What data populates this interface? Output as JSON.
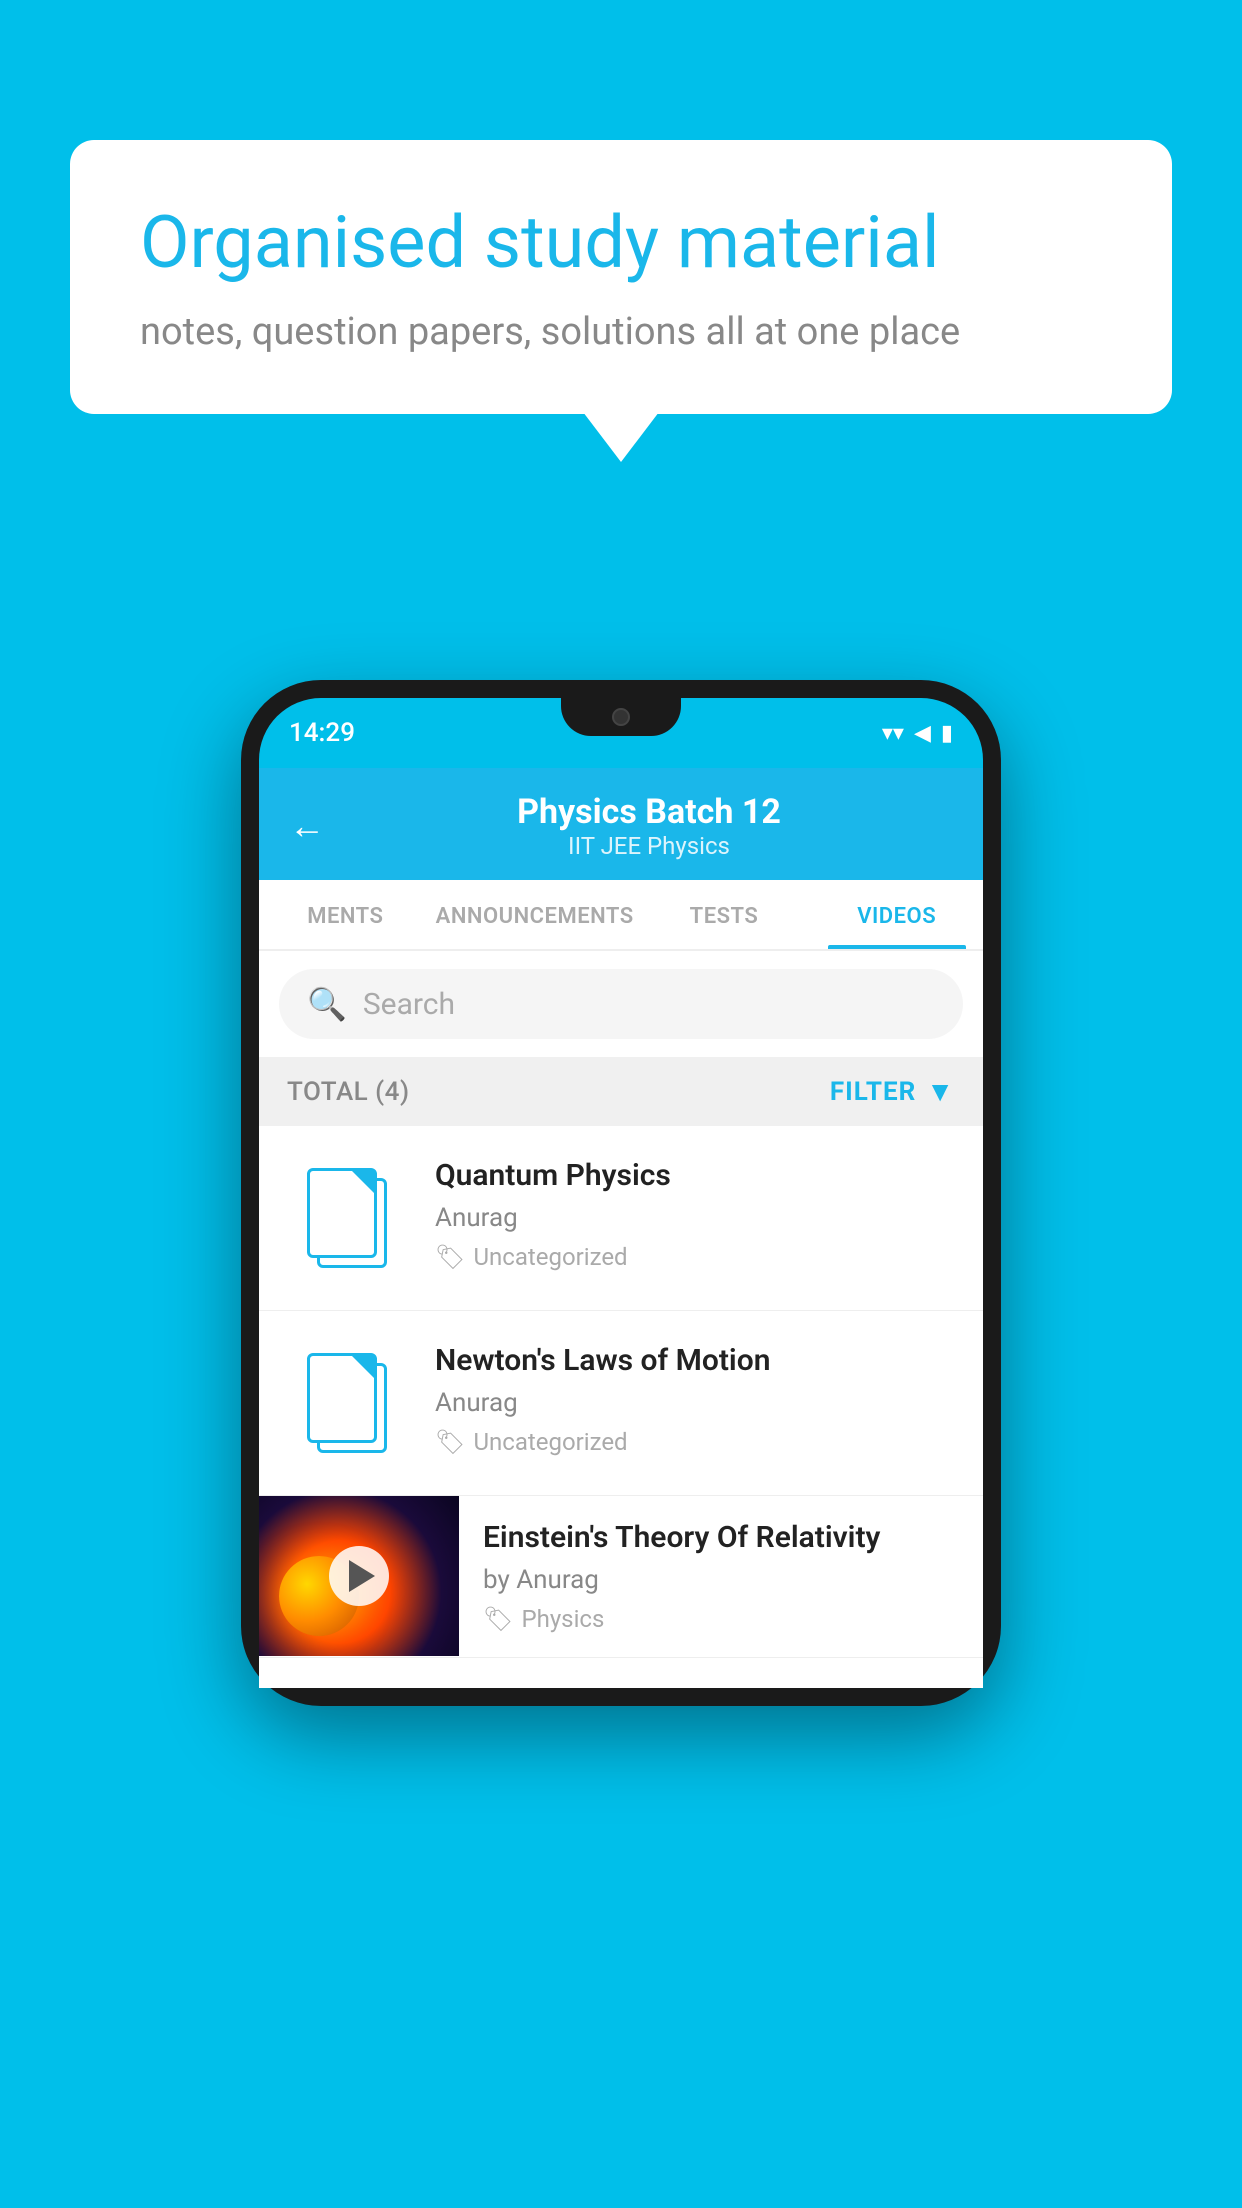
{
  "background_color": "#00BFEA",
  "speech_bubble": {
    "title": "Organised study material",
    "subtitle": "notes, question papers, solutions all at one place"
  },
  "phone": {
    "status_bar": {
      "time": "14:29",
      "wifi": "▾",
      "signal": "▲",
      "battery": "▮"
    },
    "header": {
      "back_label": "←",
      "title": "Physics Batch 12",
      "subtitle": "IIT JEE   Physics"
    },
    "tabs": [
      {
        "label": "MENTS",
        "active": false
      },
      {
        "label": "ANNOUNCEMENTS",
        "active": false
      },
      {
        "label": "TESTS",
        "active": false
      },
      {
        "label": "VIDEOS",
        "active": true
      }
    ],
    "search": {
      "placeholder": "Search"
    },
    "filter_row": {
      "total_label": "TOTAL (4)",
      "filter_label": "FILTER"
    },
    "videos": [
      {
        "id": 1,
        "title": "Quantum Physics",
        "author": "Anurag",
        "tag": "Uncategorized",
        "has_thumbnail": false
      },
      {
        "id": 2,
        "title": "Newton's Laws of Motion",
        "author": "Anurag",
        "tag": "Uncategorized",
        "has_thumbnail": false
      },
      {
        "id": 3,
        "title": "Einstein's Theory Of Relativity",
        "author": "by Anurag",
        "tag": "Physics",
        "has_thumbnail": true
      }
    ]
  }
}
